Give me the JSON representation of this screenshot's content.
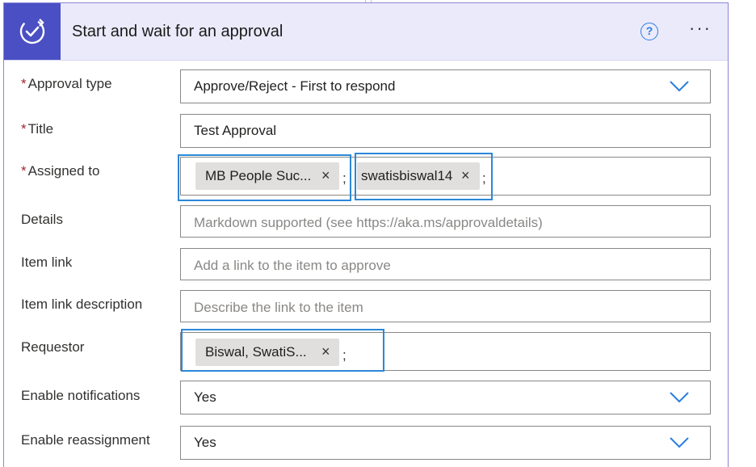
{
  "card": {
    "title": "Start and wait for an approval",
    "header_icon": "approval-check-icon",
    "help_label": "?",
    "more_label": "···"
  },
  "fields": {
    "approval_type": {
      "label": "Approval type",
      "required_mark": "*",
      "value": "Approve/Reject - First to respond"
    },
    "title": {
      "label": "Title",
      "required_mark": "*",
      "value": "Test Approval"
    },
    "assigned_to": {
      "label": "Assigned to",
      "required_mark": "*",
      "tokens": [
        {
          "text": "MB People Suc...",
          "remove": "×"
        },
        {
          "text": "swatisbiswal14",
          "remove": "×"
        }
      ],
      "separator": ";"
    },
    "details": {
      "label": "Details",
      "placeholder": "Markdown supported (see https://aka.ms/approvaldetails)"
    },
    "item_link": {
      "label": "Item link",
      "placeholder": "Add a link to the item to approve"
    },
    "item_link_description": {
      "label": "Item link description",
      "placeholder": "Describe the link to the item"
    },
    "requestor": {
      "label": "Requestor",
      "tokens": [
        {
          "text": "Biswal, SwatiS...",
          "remove": "×"
        }
      ],
      "separator": ";"
    },
    "enable_notifications": {
      "label": "Enable notifications",
      "value": "Yes"
    },
    "enable_reassignment": {
      "label": "Enable reassignment",
      "value": "Yes"
    }
  },
  "colors": {
    "header_bg": "#ebeafb",
    "icon_tile": "#4a4fc4",
    "accent_blue": "#2a7de1",
    "highlight": "#2b88d8",
    "required": "#a4262c"
  }
}
